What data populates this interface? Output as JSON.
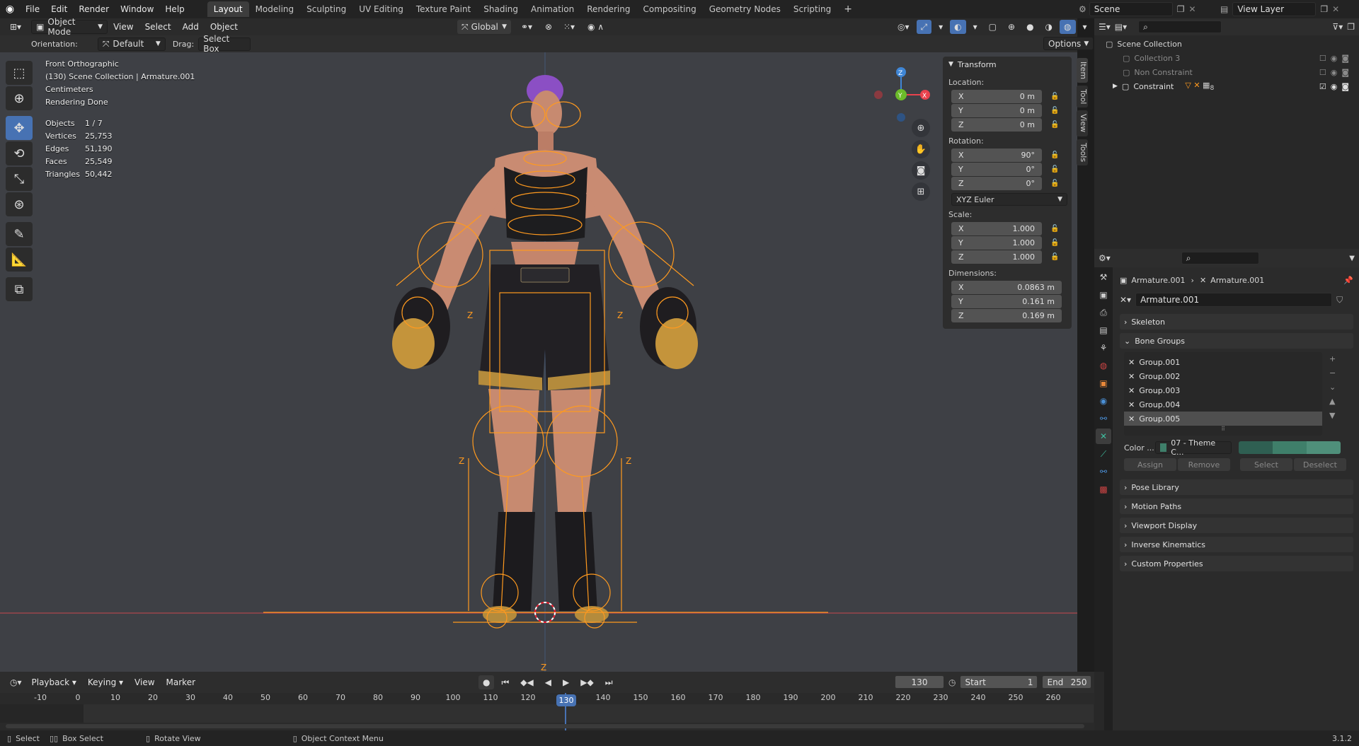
{
  "topbar": {
    "menus": [
      "File",
      "Edit",
      "Render",
      "Window",
      "Help"
    ],
    "workspaces": [
      "Layout",
      "Modeling",
      "Sculpting",
      "UV Editing",
      "Texture Paint",
      "Shading",
      "Animation",
      "Rendering",
      "Compositing",
      "Geometry Nodes",
      "Scripting"
    ],
    "active_workspace": "Layout",
    "add_tab": "+",
    "scene": "Scene",
    "view_layer": "View Layer"
  },
  "viewport_header": {
    "mode": "Object Mode",
    "menus": [
      "View",
      "Select",
      "Add",
      "Object"
    ],
    "transform_orientation": "Global"
  },
  "tool_settings": {
    "orientation_label": "Orientation:",
    "orientation_value": "Default",
    "drag_label": "Drag:",
    "drag_value": "Select Box",
    "options": "Options"
  },
  "overlay": {
    "view_name": "Front Orthographic",
    "collection": "(130) Scene Collection | Armature.001",
    "units": "Centimeters",
    "render_status": "Rendering Done",
    "stats": [
      {
        "label": "Objects",
        "value": "1 / 7"
      },
      {
        "label": "Vertices",
        "value": "25,753"
      },
      {
        "label": "Edges",
        "value": "51,190"
      },
      {
        "label": "Faces",
        "value": "25,549"
      },
      {
        "label": "Triangles",
        "value": "50,442"
      }
    ],
    "gizmo": {
      "z": "Z",
      "y": "Y",
      "x": "X"
    }
  },
  "npanel": {
    "title": "Transform",
    "location_label": "Location:",
    "location": [
      {
        "axis": "X",
        "value": "0 m"
      },
      {
        "axis": "Y",
        "value": "0 m"
      },
      {
        "axis": "Z",
        "value": "0 m"
      }
    ],
    "rotation_label": "Rotation:",
    "rotation": [
      {
        "axis": "X",
        "value": "90°"
      },
      {
        "axis": "Y",
        "value": "0°"
      },
      {
        "axis": "Z",
        "value": "0°"
      }
    ],
    "rotation_mode": "XYZ Euler",
    "scale_label": "Scale:",
    "scale": [
      {
        "axis": "X",
        "value": "1.000"
      },
      {
        "axis": "Y",
        "value": "1.000"
      },
      {
        "axis": "Z",
        "value": "1.000"
      }
    ],
    "dimensions_label": "Dimensions:",
    "dimensions": [
      {
        "axis": "X",
        "value": "0.0863 m"
      },
      {
        "axis": "Y",
        "value": "0.161 m"
      },
      {
        "axis": "Z",
        "value": "0.169 m"
      }
    ],
    "side_tabs": [
      "Item",
      "Tool",
      "View",
      "Tools"
    ]
  },
  "outliner": {
    "root": "Scene Collection",
    "items": [
      {
        "name": "Collection 3",
        "dim": true
      },
      {
        "name": "Non Constraint",
        "dim": true
      },
      {
        "name": "Constraint",
        "dim": false,
        "badge": "8"
      }
    ]
  },
  "properties": {
    "breadcrumb_object": "Armature.001",
    "breadcrumb_data": "Armature.001",
    "datablock_name": "Armature.001",
    "panels_top": [
      "Skeleton"
    ],
    "bone_groups_title": "Bone Groups",
    "bone_groups": [
      "Group.001",
      "Group.002",
      "Group.003",
      "Group.004",
      "Group.005"
    ],
    "selected_group": "Group.005",
    "color_label": "Color ...",
    "color_set": "07 - Theme C...",
    "buttons": [
      "Assign",
      "Remove",
      "Select",
      "Deselect"
    ],
    "panels_bottom": [
      "Pose Library",
      "Motion Paths",
      "Viewport Display",
      "Inverse Kinematics",
      "Custom Properties"
    ]
  },
  "timeline": {
    "menus": [
      "Playback",
      "Keying",
      "View",
      "Marker"
    ],
    "current_frame": "130",
    "start_label": "Start",
    "start": "1",
    "end_label": "End",
    "end": "250",
    "ruler": [
      "-10",
      "0",
      "10",
      "20",
      "30",
      "40",
      "50",
      "60",
      "70",
      "80",
      "90",
      "100",
      "110",
      "120",
      "130",
      "140",
      "150",
      "160",
      "170",
      "180",
      "190",
      "200",
      "210",
      "220",
      "230",
      "240",
      "250",
      "260"
    ]
  },
  "statusbar": {
    "select": "Select",
    "box_select": "Box Select",
    "rotate_view": "Rotate View",
    "context_menu": "Object Context Menu",
    "version": "3.1.2"
  },
  "colors": {
    "accent": "#4772b3",
    "armature": "#ff9a1f",
    "x_axis": "#e8424d",
    "y_axis": "#6cbb2a",
    "z_axis": "#3f86d6",
    "theme_green": "#3f7f6a"
  }
}
